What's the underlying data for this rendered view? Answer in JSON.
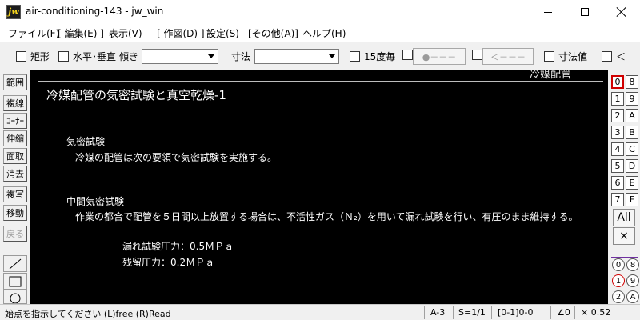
{
  "window": {
    "app_icon_text": "jw",
    "title": "air-conditioning-143 - jw_win"
  },
  "menu": {
    "items": [
      "ファイル(F)",
      "[ 編集(E) ]",
      "表示(V)",
      "[ 作図(D) ]",
      "設定(S)",
      "[その他(A)]",
      "ヘルプ(H)"
    ]
  },
  "toolbar": {
    "rect_label": "矩形",
    "hv_label": "水平･垂直",
    "tilt_label": "傾き",
    "dim_label": "寸法",
    "deg15_label": "15度毎",
    "btn_dot_label": "●－－－",
    "btn_arrow_label": "＜－－－",
    "dim_value_label": "寸法値",
    "lt_label": "＜"
  },
  "left_tools": {
    "buttons": [
      "範囲",
      "複線",
      "ｺｰﾅｰ",
      "伸縮",
      "面取",
      "消去",
      "複写",
      "移動",
      "戻る"
    ],
    "disabled_index": 8
  },
  "canvas": {
    "corner_text": "冷媒配管",
    "heading": "冷媒配管の気密試験と真空乾燥-1",
    "section1_title": "気密試験",
    "section1_body": "冷媒の配管は次の要領で気密試験を実施する。",
    "section2_title": "中間気密試験",
    "section2_body": "作業の都合で配管を５日間以上放置する場合は、不活性ガス（Ｎ₂）を用いて漏れ試験を行い、有圧のまま維持する。",
    "leak_pressure": "漏れ試験圧力：0.5ＭＰａ",
    "residual_pressure": "残留圧力：0.2ＭＰａ"
  },
  "layers": {
    "left_col": [
      "0",
      "1",
      "2",
      "3",
      "4",
      "5",
      "6",
      "7"
    ],
    "right_col": [
      "8",
      "9",
      "A",
      "B",
      "C",
      "D",
      "E",
      "F"
    ],
    "all_label": "All",
    "x_label": "×",
    "group_left": [
      "0",
      "1",
      "2"
    ],
    "group_right": [
      "8",
      "9",
      "A"
    ]
  },
  "status": {
    "prompt": "始点を指示してください (L)free (R)Read",
    "paper": "A-3",
    "scale": "S=1/1",
    "layer": "[0-1]0-0",
    "angle": "∠0",
    "zoom": "× 0.52"
  }
}
